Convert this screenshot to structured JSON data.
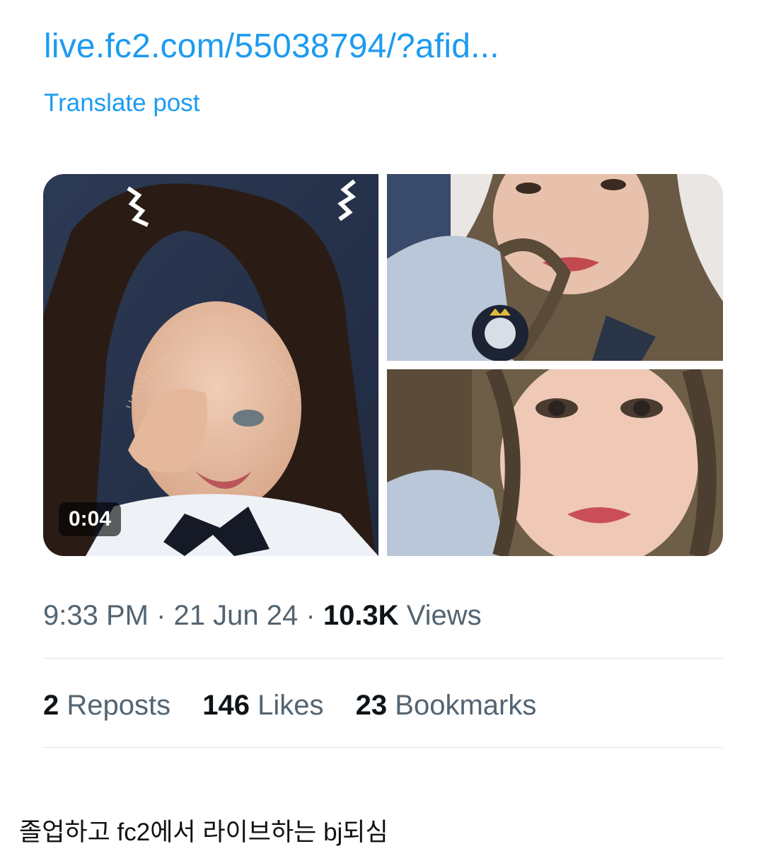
{
  "post": {
    "link_text": "live.fc2.com/55038794/?afid...",
    "translate_label": "Translate post"
  },
  "media": {
    "video_duration": "0:04"
  },
  "meta": {
    "time": "9:33 PM",
    "separator": "·",
    "date": "21 Jun 24",
    "views_count": "10.3K",
    "views_label": "Views"
  },
  "stats": {
    "reposts_count": "2",
    "reposts_label": "Reposts",
    "likes_count": "146",
    "likes_label": "Likes",
    "bookmarks_count": "23",
    "bookmarks_label": "Bookmarks"
  },
  "caption": "졸업하고 fc2에서 라이브하는 bj되심",
  "colors": {
    "link": "#1d9bf0",
    "secondary_text": "#536471",
    "primary_text": "#0f1419",
    "divider": "#dfe4e8"
  }
}
